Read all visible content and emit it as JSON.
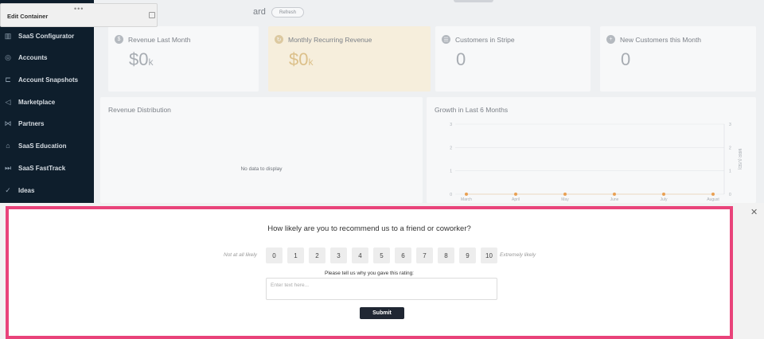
{
  "edit_container": {
    "label": "Edit Container",
    "dots": "•••"
  },
  "sidebar": {
    "items": [
      {
        "label": "SaaS Configurator",
        "icon": "chart-bars-icon",
        "glyph": "▥"
      },
      {
        "label": "Accounts",
        "icon": "location-pin-icon",
        "glyph": "◎"
      },
      {
        "label": "Account Snapshots",
        "icon": "snapshot-icon",
        "glyph": "⊏"
      },
      {
        "label": "Marketplace",
        "icon": "megaphone-icon",
        "glyph": "◁"
      },
      {
        "label": "Partners",
        "icon": "handshake-icon",
        "glyph": "⋈"
      },
      {
        "label": "SaaS Education",
        "icon": "graduation-icon",
        "glyph": "⌂"
      },
      {
        "label": "SaaS FastTrack",
        "icon": "fast-forward-icon",
        "glyph": "⏭"
      },
      {
        "label": "Ideas",
        "icon": "check-circle-icon",
        "glyph": "✓"
      }
    ]
  },
  "header": {
    "title_fragment": "ard",
    "refresh_label": "Refresh"
  },
  "stats": [
    {
      "title": "Revenue Last Month",
      "value": "$0",
      "unit": "k",
      "icon": "dollar-icon",
      "glyph": "$",
      "highlight": false
    },
    {
      "title": "Monthly Recurring Revenue",
      "value": "$0",
      "unit": "k",
      "icon": "recurring-icon",
      "glyph": "↻",
      "highlight": true
    },
    {
      "title": "Customers in Stripe",
      "value": "0",
      "unit": "",
      "icon": "customers-icon",
      "glyph": "☰",
      "highlight": false
    },
    {
      "title": "New Customers this Month",
      "value": "0",
      "unit": "",
      "icon": "new-customer-icon",
      "glyph": "+",
      "highlight": false
    }
  ],
  "revenue_panel": {
    "title": "Revenue Distribution",
    "empty_text": "No data to display"
  },
  "growth_panel": {
    "title": "Growth in Last 6 Months",
    "right_axis_label": "MRR (USD)",
    "chart_data": {
      "type": "line",
      "x": [
        "March",
        "April",
        "May",
        "June",
        "July",
        "August"
      ],
      "series": [
        {
          "values": [
            0,
            0,
            0,
            0,
            0,
            0
          ]
        }
      ],
      "yticks_left": [
        "0",
        "1",
        "2",
        "3"
      ],
      "yticks_right": [
        "0",
        "1",
        "2",
        "3"
      ],
      "ylim": [
        0,
        3
      ],
      "point_color": "#e9a053"
    }
  },
  "survey": {
    "question": "How likely are you to recommend us to a friend or coworker?",
    "low_label": "Not at all likely",
    "high_label": "Extremely likely",
    "scores": [
      "0",
      "1",
      "2",
      "3",
      "4",
      "5",
      "6",
      "7",
      "8",
      "9",
      "10"
    ],
    "why_label": "Please tell us why you gave this rating:",
    "placeholder": "Enter text here...",
    "submit_label": "Submit",
    "close_glyph": "✕",
    "border_color": "#e9437a"
  }
}
